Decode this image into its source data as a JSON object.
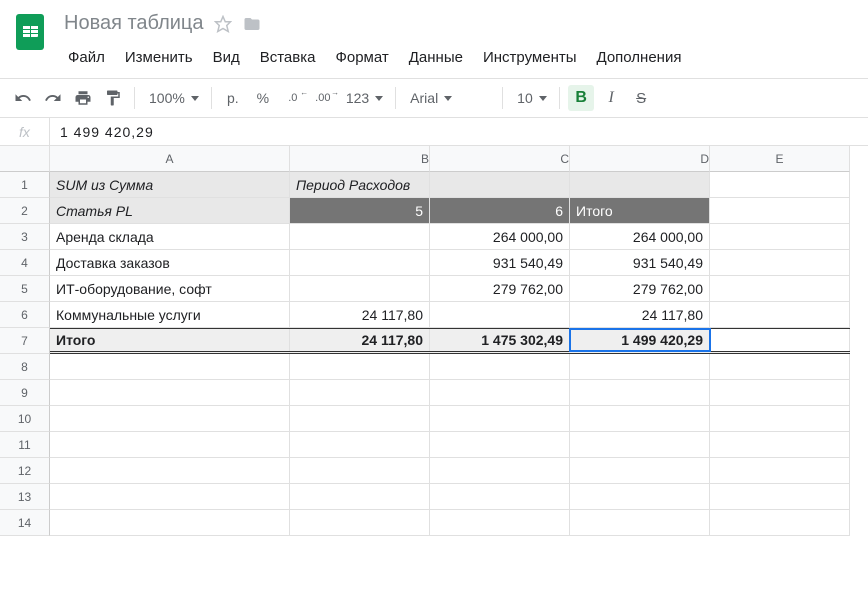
{
  "doc": {
    "title": "Новая таблица"
  },
  "menu": {
    "file": "Файл",
    "edit": "Изменить",
    "view": "Вид",
    "insert": "Вставка",
    "format": "Формат",
    "data": "Данные",
    "tools": "Инструменты",
    "addons": "Дополнения"
  },
  "toolbar": {
    "zoom": "100%",
    "currency": "р.",
    "percent": "%",
    "dec_dec": ".0",
    "dec_inc": ".00",
    "more_fmt": "123",
    "font": "Arial",
    "font_size": "10",
    "bold": "B",
    "italic": "I",
    "strike": "S"
  },
  "formula_bar": {
    "value": "1 499 420,29"
  },
  "columns": [
    "A",
    "B",
    "C",
    "D",
    "E"
  ],
  "rows": [
    "1",
    "2",
    "3",
    "4",
    "5",
    "6",
    "7",
    "8",
    "9",
    "10",
    "11",
    "12",
    "13",
    "14"
  ],
  "sheet": {
    "r1": {
      "a": "SUM из Сумма",
      "b": "Период Расходов"
    },
    "r2": {
      "a": "Статья PL",
      "b": "5",
      "c": "6",
      "d": "Итого"
    },
    "r3": {
      "a": "Аренда склада",
      "b": "",
      "c": "264 000,00",
      "d": "264 000,00"
    },
    "r4": {
      "a": "Доставка заказов",
      "b": "",
      "c": "931 540,49",
      "d": "931 540,49"
    },
    "r5": {
      "a": "ИТ-оборудование, софт",
      "b": "",
      "c": "279 762,00",
      "d": "279 762,00"
    },
    "r6": {
      "a": "Коммунальные услуги",
      "b": "24 117,80",
      "c": "",
      "d": "24 117,80"
    },
    "r7": {
      "a": "Итого",
      "b": "24 117,80",
      "c": "1 475 302,49",
      "d": "1 499 420,29"
    }
  },
  "chart_data": {
    "type": "table",
    "title": "SUM из Сумма — Период Расходов",
    "columns": [
      "Статья PL",
      "5",
      "6",
      "Итого"
    ],
    "rows": [
      [
        "Аренда склада",
        null,
        264000.0,
        264000.0
      ],
      [
        "Доставка заказов",
        null,
        931540.49,
        931540.49
      ],
      [
        "ИТ-оборудование, софт",
        null,
        279762.0,
        279762.0
      ],
      [
        "Коммунальные услуги",
        24117.8,
        null,
        24117.8
      ],
      [
        "Итого",
        24117.8,
        1475302.49,
        1499420.29
      ]
    ]
  }
}
